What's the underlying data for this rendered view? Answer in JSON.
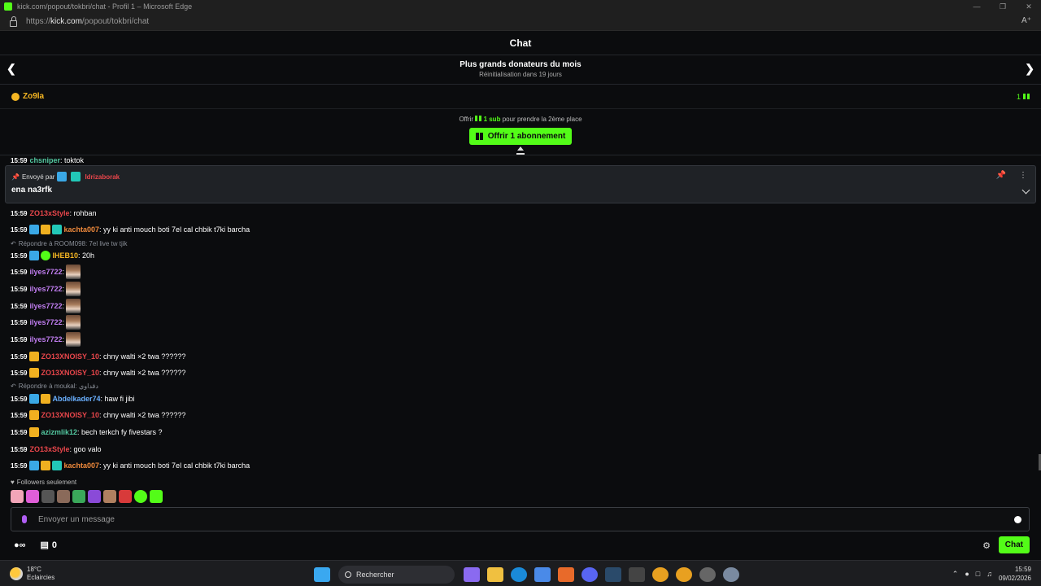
{
  "window": {
    "title": "kick.com/popout/tokbri/chat - Profil 1 – Microsoft Edge",
    "url_prefix": "https://",
    "url_host": "kick.com",
    "url_path": "/popout/tokbri/chat"
  },
  "header": {
    "title": "Chat"
  },
  "donors": {
    "title": "Plus grands donateurs du mois",
    "subtitle": "Réinitialisation dans 19 jours"
  },
  "leader": {
    "name": "Zo9la",
    "count": "1"
  },
  "offer": {
    "prefix": "Offrir",
    "sub": "1 sub",
    "suffix": "pour prendre la 2ème place",
    "button": "Offrir 1 abonnement"
  },
  "partial_msg": {
    "ts": "15:59",
    "user": "chsniper",
    "text": ": toktok"
  },
  "pinned": {
    "sent_by": "Envoyé par",
    "user": "Idrizaborak",
    "text": "ena na3rfk"
  },
  "messages": [
    {
      "ts": "15:59",
      "user": "ZO13xStyle",
      "color": "#e8464b",
      "text": ": rohban",
      "badges": []
    },
    {
      "ts": "15:59",
      "user": "kachta007",
      "color": "#f08a3c",
      "text": ": yy ki anti mouch boti 7el cal chbik t7ki barcha",
      "badges": [
        "b-blue",
        "b-gold",
        "b-teal"
      ]
    },
    {
      "ts": "15:59",
      "user": "IHEB10",
      "color": "#f5b623",
      "text": ": 20h",
      "badges": [
        "b-blue",
        "b-verif"
      ]
    },
    {
      "ts": "15:59",
      "user": "ilyes7722",
      "color": "#c07df0",
      "text": ":",
      "badges": []
    },
    {
      "ts": "15:59",
      "user": "ilyes7722",
      "color": "#c07df0",
      "text": ":",
      "badges": []
    },
    {
      "ts": "15:59",
      "user": "ilyes7722",
      "color": "#c07df0",
      "text": ":",
      "badges": []
    },
    {
      "ts": "15:59",
      "user": "ilyes7722",
      "color": "#c07df0",
      "text": ":",
      "badges": []
    },
    {
      "ts": "15:59",
      "user": "ilyes7722",
      "color": "#c07df0",
      "text": ":",
      "badges": []
    },
    {
      "ts": "15:59",
      "user": "ZO13XNOISY_10",
      "color": "#e8464b",
      "text": ": chny walti ×2 twa ??????",
      "badges": [
        "b-gold"
      ]
    },
    {
      "ts": "15:59",
      "user": "ZO13XNOISY_10",
      "color": "#e8464b",
      "text": ": chny walti ×2 twa ??????",
      "badges": [
        "b-gold"
      ]
    },
    {
      "ts": "15:59",
      "user": "Abdelkader74",
      "color": "#6ab0ff",
      "text": ": haw fi jibi",
      "badges": [
        "b-blue",
        "b-gold"
      ]
    },
    {
      "ts": "15:59",
      "user": "ZO13XNOISY_10",
      "color": "#e8464b",
      "text": ": chny walti ×2 twa ??????",
      "badges": [
        "b-gold"
      ]
    },
    {
      "ts": "15:59",
      "user": "azizmlik12",
      "color": "#53c8a0",
      "text": ": bech terkch fy fivestars ?",
      "badges": [
        "b-gold"
      ]
    },
    {
      "ts": "15:59",
      "user": "ZO13xStyle",
      "color": "#e8464b",
      "text": ": goo valo",
      "badges": []
    },
    {
      "ts": "15:59",
      "user": "kachta007",
      "color": "#f08a3c",
      "text": ": yy ki anti mouch boti 7el cal chbik t7ki barcha",
      "badges": [
        "b-blue",
        "b-gold",
        "b-teal"
      ]
    }
  ],
  "replies": [
    {
      "text": "Répondre à ROOM098: 7el live tw tjik"
    },
    {
      "text": "Répondre à moukal: دقداوي"
    }
  ],
  "followers_only": "Followers seulement",
  "input": {
    "placeholder": "Envoyer un message"
  },
  "bottom": {
    "counter": "0",
    "chat_button": "Chat"
  },
  "taskbar": {
    "weather_temp": "18°C",
    "weather_desc": "Eclaircies",
    "search": "Rechercher",
    "time": "15:59",
    "date": "09/02/2026"
  }
}
